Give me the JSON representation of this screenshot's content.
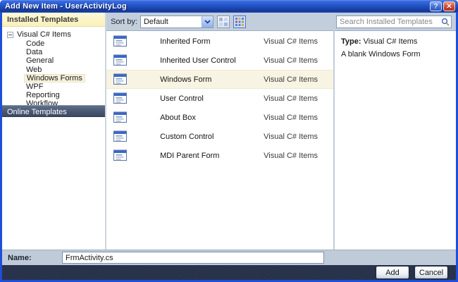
{
  "window": {
    "title": "Add New Item - UserActivityLog",
    "help_glyph": "?",
    "close_glyph": "✕"
  },
  "sidebar": {
    "installed_header": "Installed Templates",
    "tree_root": "Visual C# Items",
    "items": [
      "Code",
      "Data",
      "General",
      "Web",
      "Windows Forms",
      "WPF",
      "Reporting",
      "Workflow"
    ],
    "selected_item": "Windows Forms",
    "online_header": "Online Templates"
  },
  "toolbar": {
    "sort_label": "Sort by:",
    "sort_value": "Default"
  },
  "search": {
    "placeholder": "Search Installed Templates"
  },
  "templates": [
    {
      "name": "Inherited Form",
      "type": "Visual C# Items",
      "selected": false
    },
    {
      "name": "Inherited User Control",
      "type": "Visual C# Items",
      "selected": false
    },
    {
      "name": "Windows Form",
      "type": "Visual C# Items",
      "selected": true
    },
    {
      "name": "User Control",
      "type": "Visual C# Items",
      "selected": false
    },
    {
      "name": "About Box",
      "type": "Visual C# Items",
      "selected": false
    },
    {
      "name": "Custom Control",
      "type": "Visual C# Items",
      "selected": false
    },
    {
      "name": "MDI Parent Form",
      "type": "Visual C# Items",
      "selected": false
    }
  ],
  "details": {
    "type_label": "Type:",
    "type_value": "Visual C# Items",
    "description": "A blank Windows Form"
  },
  "name_row": {
    "label": "Name:",
    "value": "FrmActivity.cs"
  },
  "actions": {
    "add": "Add",
    "cancel": "Cancel"
  },
  "icons": {
    "help": "question-mark-icon",
    "close": "close-icon",
    "search": "magnifier-icon",
    "sort_dropdown": "chevron-down-icon",
    "view_small": "small-icons-view-icon",
    "view_large": "medium-icons-view-icon",
    "template_item": "form-template-icon",
    "tree_expander": "collapse-minus-icon"
  },
  "colors": {
    "titlebar_blue": "#2153c8",
    "dialog_border_blue": "#1e4fd8",
    "selection_cream": "#f8f4e3",
    "header_cream": "#faf1bb",
    "online_bar_slate": "#46546f",
    "footer_navy": "#263149",
    "strip_gray": "#c3cedc"
  }
}
